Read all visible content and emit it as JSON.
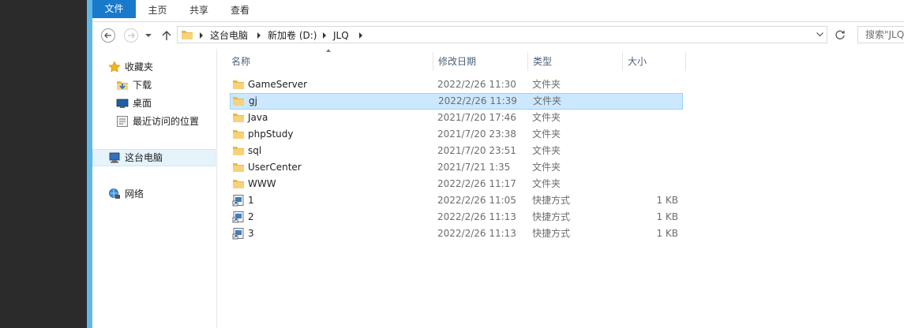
{
  "ribbon": {
    "tabs": [
      {
        "label": "文件",
        "active": true
      },
      {
        "label": "主页",
        "active": false
      },
      {
        "label": "共享",
        "active": false
      },
      {
        "label": "查看",
        "active": false
      }
    ]
  },
  "address": {
    "crumbs": [
      "这台电脑",
      "新加卷 (D:)",
      "JLQ"
    ],
    "search_text": "搜索\"JLQ\""
  },
  "nav": {
    "favorites": {
      "label": "收藏夹",
      "icon": "star-icon"
    },
    "favorite_items": [
      {
        "label": "下载",
        "icon": "download-folder-icon"
      },
      {
        "label": "桌面",
        "icon": "desktop-icon"
      },
      {
        "label": "最近访问的位置",
        "icon": "recent-places-icon"
      }
    ],
    "this_pc": {
      "label": "这台电脑",
      "icon": "computer-icon"
    },
    "network": {
      "label": "网络",
      "icon": "network-icon"
    }
  },
  "columns": {
    "name": "名称",
    "date": "修改日期",
    "type": "类型",
    "size": "大小"
  },
  "files": [
    {
      "name": "GameServer",
      "date": "2022/2/26 11:30",
      "type": "文件夹",
      "size": "",
      "icon": "folder-icon",
      "selected": false
    },
    {
      "name": "gj",
      "date": "2022/2/26 11:39",
      "type": "文件夹",
      "size": "",
      "icon": "folder-icon",
      "selected": true
    },
    {
      "name": "Java",
      "date": "2021/7/20 17:46",
      "type": "文件夹",
      "size": "",
      "icon": "folder-icon",
      "selected": false
    },
    {
      "name": "phpStudy",
      "date": "2021/7/20 23:38",
      "type": "文件夹",
      "size": "",
      "icon": "folder-icon",
      "selected": false
    },
    {
      "name": "sql",
      "date": "2021/7/20 23:51",
      "type": "文件夹",
      "size": "",
      "icon": "folder-icon",
      "selected": false
    },
    {
      "name": "UserCenter",
      "date": "2021/7/21 1:35",
      "type": "文件夹",
      "size": "",
      "icon": "folder-icon",
      "selected": false
    },
    {
      "name": "WWW",
      "date": "2022/2/26 11:17",
      "type": "文件夹",
      "size": "",
      "icon": "folder-icon",
      "selected": false
    },
    {
      "name": "1",
      "date": "2022/2/26 11:05",
      "type": "快捷方式",
      "size": "1 KB",
      "icon": "shortcut-icon",
      "selected": false
    },
    {
      "name": "2",
      "date": "2022/2/26 11:13",
      "type": "快捷方式",
      "size": "1 KB",
      "icon": "shortcut-icon",
      "selected": false
    },
    {
      "name": "3",
      "date": "2022/2/26 11:13",
      "type": "快捷方式",
      "size": "1 KB",
      "icon": "shortcut-icon",
      "selected": false
    }
  ],
  "colors": {
    "accent": "#1979ca",
    "selection": "#cce8ff",
    "frame": "#5fb8e6"
  }
}
